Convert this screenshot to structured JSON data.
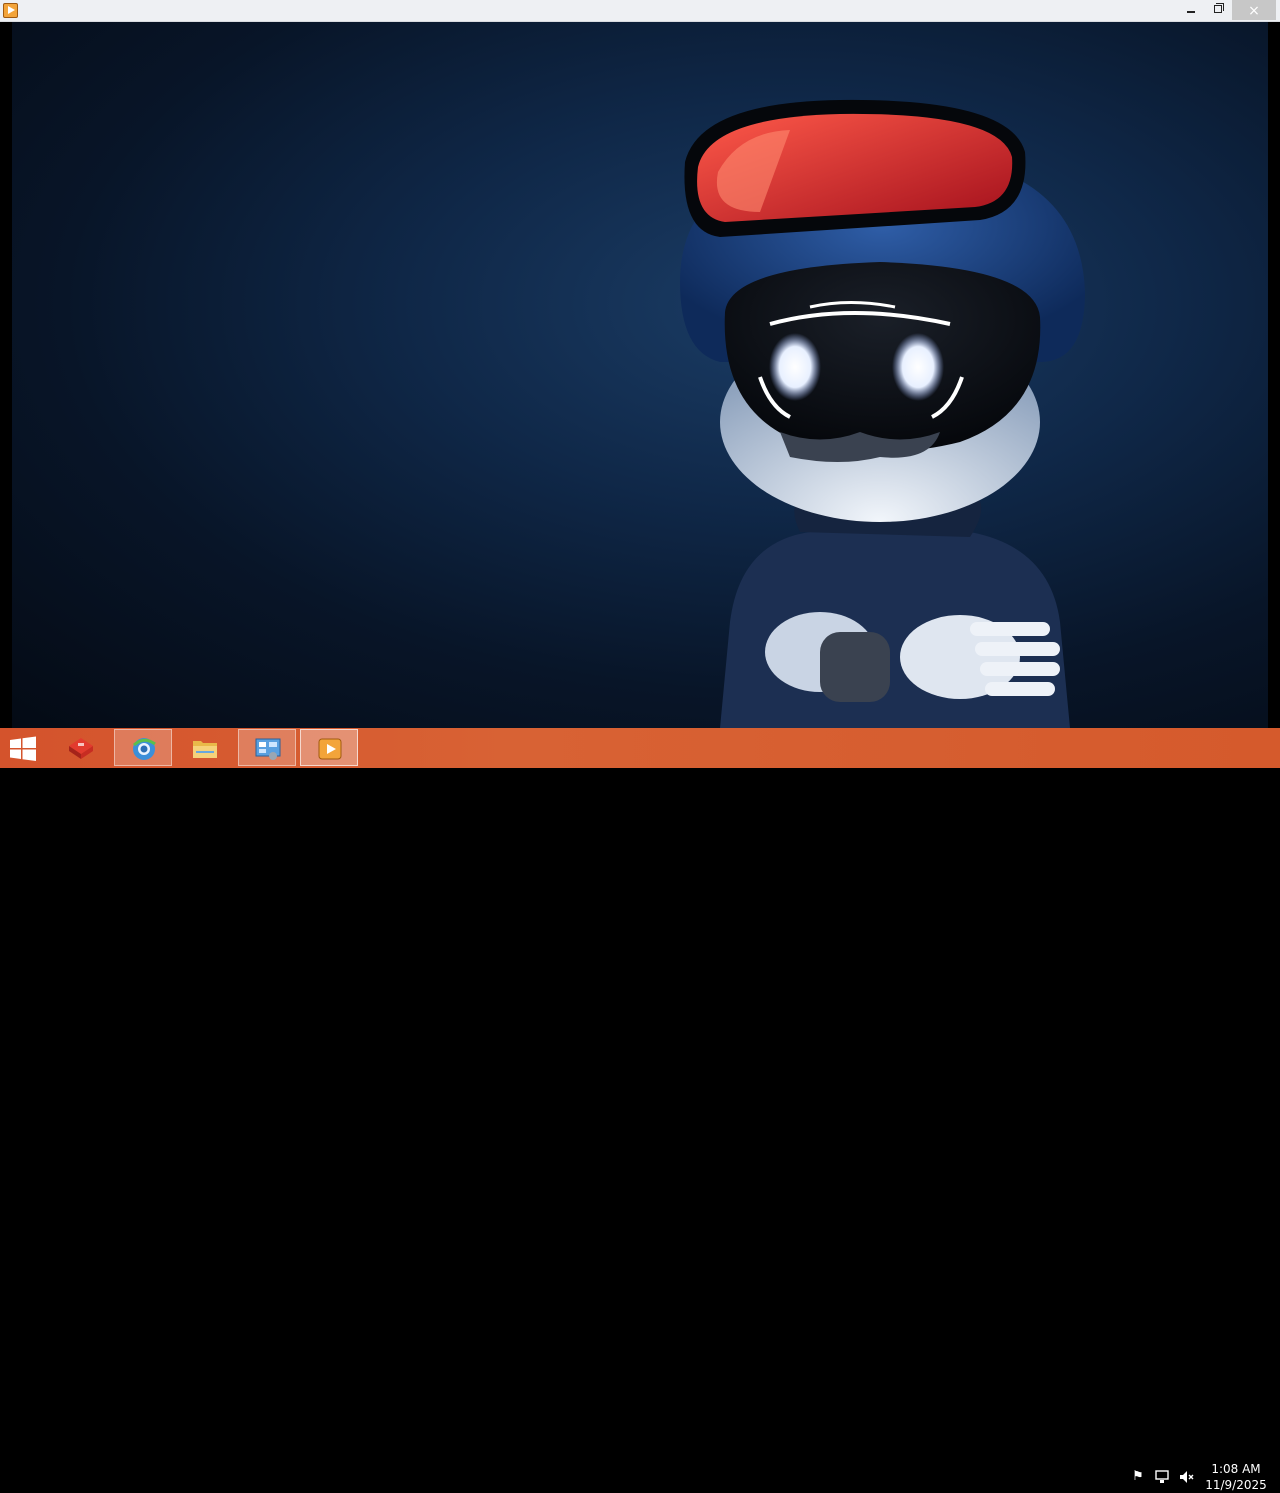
{
  "window": {
    "app_icon": "media-player-icon",
    "controls": {
      "minimize": "minimize-icon",
      "maximize": "restore-icon",
      "close": "×"
    }
  },
  "content": {
    "description_icon": "video-frame"
  },
  "taskbar": {
    "start_icon": "windows-logo-icon",
    "items": [
      {
        "name": "toolbox-app",
        "icon": "red-toolbox-icon"
      },
      {
        "name": "browser",
        "icon": "browser-globe-icon"
      },
      {
        "name": "file-explorer",
        "icon": "folder-icon"
      },
      {
        "name": "control-panel",
        "icon": "control-panel-icon"
      },
      {
        "name": "media-player",
        "icon": "media-player-icon"
      }
    ],
    "tray": {
      "flag_icon": "action-center-flag-icon",
      "network_icon": "network-icon",
      "volume_icon": "volume-muted-icon"
    },
    "clock": {
      "time": "1:08 AM",
      "date": "11/9/2025"
    }
  },
  "colors": {
    "taskbar": "#d55a2c",
    "titlebar": "#eef0f3",
    "background": "#0f2747"
  }
}
